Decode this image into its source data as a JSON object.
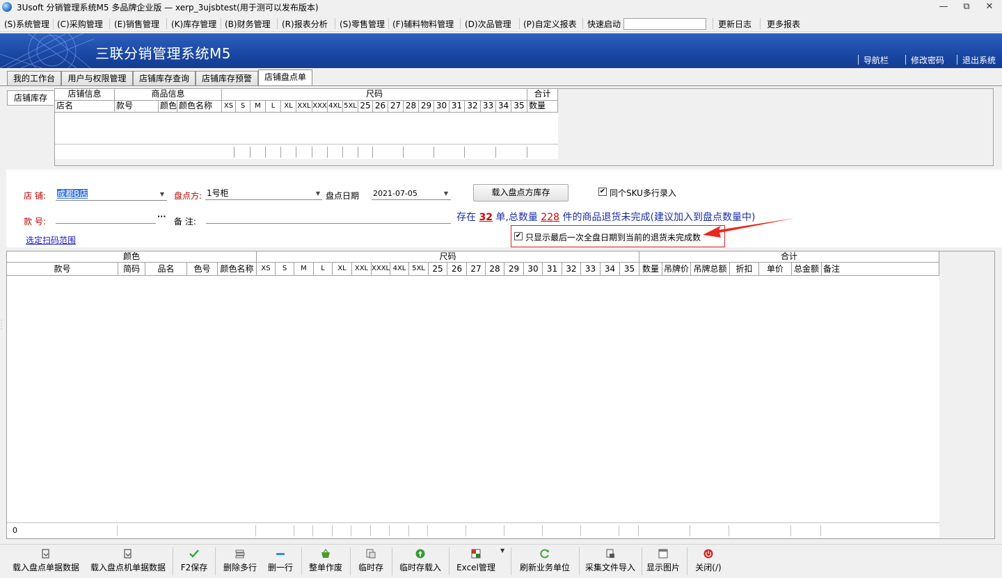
{
  "window": {
    "title": "3Usoft 分销管理系统M5 多品牌企业版 — xerp_3ujsbtest(用于测可以发布版本)",
    "minimize": "—",
    "restore": "⧉",
    "close": "✕"
  },
  "menu": [
    {
      "label": "(S)系统管理"
    },
    {
      "label": "(C)采购管理"
    },
    {
      "label": "(E)销售管理"
    },
    {
      "label": "(K)库存管理"
    },
    {
      "label": "(B)财务管理"
    },
    {
      "label": "(R)报表分析"
    },
    {
      "label": "(S)零售管理"
    },
    {
      "label": "(F)辅料物料管理"
    },
    {
      "label": "(D)次品管理"
    },
    {
      "label": "(P)自定义报表"
    }
  ],
  "quick_start": {
    "label": "快速启动",
    "value": ""
  },
  "menu_right": [
    "更新日志",
    "更多报表"
  ],
  "banner": {
    "title": "三联分销管理系统M5",
    "links": [
      "导航栏",
      "修改密码",
      "退出系统"
    ]
  },
  "tabs": [
    "我的工作台",
    "用户与权限管理",
    "店铺库存查询",
    "店铺库存预警",
    "店铺盘点单"
  ],
  "side_tab": "店铺库存",
  "top_grid": {
    "groups": [
      "店铺信息",
      "商品信息",
      "尺码",
      "合计"
    ],
    "columns": [
      "店名",
      "款号",
      "颜色",
      "颜色名称",
      "XS",
      "S",
      "M",
      "L",
      "XL",
      "XXL",
      "XXX",
      "4XL",
      "5XL",
      "25",
      "26",
      "27",
      "28",
      "29",
      "30",
      "31",
      "32",
      "33",
      "34",
      "35",
      "数量"
    ]
  },
  "form": {
    "store_label": "店 铺:",
    "store_value": "成都B店",
    "location_label": "盘点方:",
    "location_value": "1号柜",
    "date_label": "盘点日期",
    "date_value": "2021-07-05",
    "load_button": "载入盘点方库存",
    "multi_row_label": "同个SKU多行录入",
    "multi_row_checked": true,
    "style_label": "款 号:",
    "style_value": "",
    "ellipsis": "···",
    "note_label": "备 注:",
    "note_value": "",
    "scan_link": "选定扫码范围",
    "info_pre": "存在",
    "info_count": "32",
    "info_mid": "单,总数量",
    "info_qty": "228",
    "info_post": "件的商品退货未完成(建议加入到盘点数量中)",
    "only_last_label": "只显示最后一次全盘日期到当前的退货未完成数",
    "only_last_checked": true
  },
  "main_grid": {
    "groups": [
      "颜色",
      "尺码",
      "合计"
    ],
    "columns": [
      "款号",
      "简码",
      "品名",
      "色号",
      "颜色名称",
      "XS",
      "S",
      "M",
      "L",
      "XL",
      "XXL",
      "XXXL",
      "4XL",
      "5XL",
      "25",
      "26",
      "27",
      "28",
      "29",
      "30",
      "31",
      "32",
      "33",
      "34",
      "35",
      "数量",
      "吊牌价",
      "吊牌总额",
      "折扣",
      "单价",
      "总金额",
      "备注"
    ],
    "footer_count": "0"
  },
  "toolbar": [
    {
      "label": "载入盘点单据数据",
      "icon": "load-doc-icon",
      "color": "#555555"
    },
    {
      "label": "载入盘点机单据数据",
      "icon": "load-device-icon",
      "color": "#555555"
    },
    {
      "label": "F2保存",
      "icon": "check-icon",
      "color": "#2f9e2f"
    },
    {
      "label": "删除多行",
      "icon": "delete-rows-icon",
      "color": "#666666"
    },
    {
      "label": "删一行",
      "icon": "minus-icon",
      "color": "#2a8ad6"
    },
    {
      "label": "整单作废",
      "icon": "basket-icon",
      "color": "#4e9a2a"
    },
    {
      "label": "临时存",
      "icon": "temp-save-icon",
      "color": "#666666"
    },
    {
      "label": "临时存载入",
      "icon": "up-arrow-icon",
      "color": "#2f9e2f"
    },
    {
      "label": "Excel管理",
      "icon": "excel-icon",
      "color": "#c0392b"
    },
    {
      "label": "刷新业务单位",
      "icon": "refresh-icon",
      "color": "#3aa53a"
    },
    {
      "label": "采集文件导入",
      "icon": "import-file-icon",
      "color": "#555555"
    },
    {
      "label": "显示图片",
      "icon": "image-icon",
      "color": "#555555"
    },
    {
      "label": "关闭(/)",
      "icon": "power-icon",
      "color": "#d42020"
    }
  ]
}
